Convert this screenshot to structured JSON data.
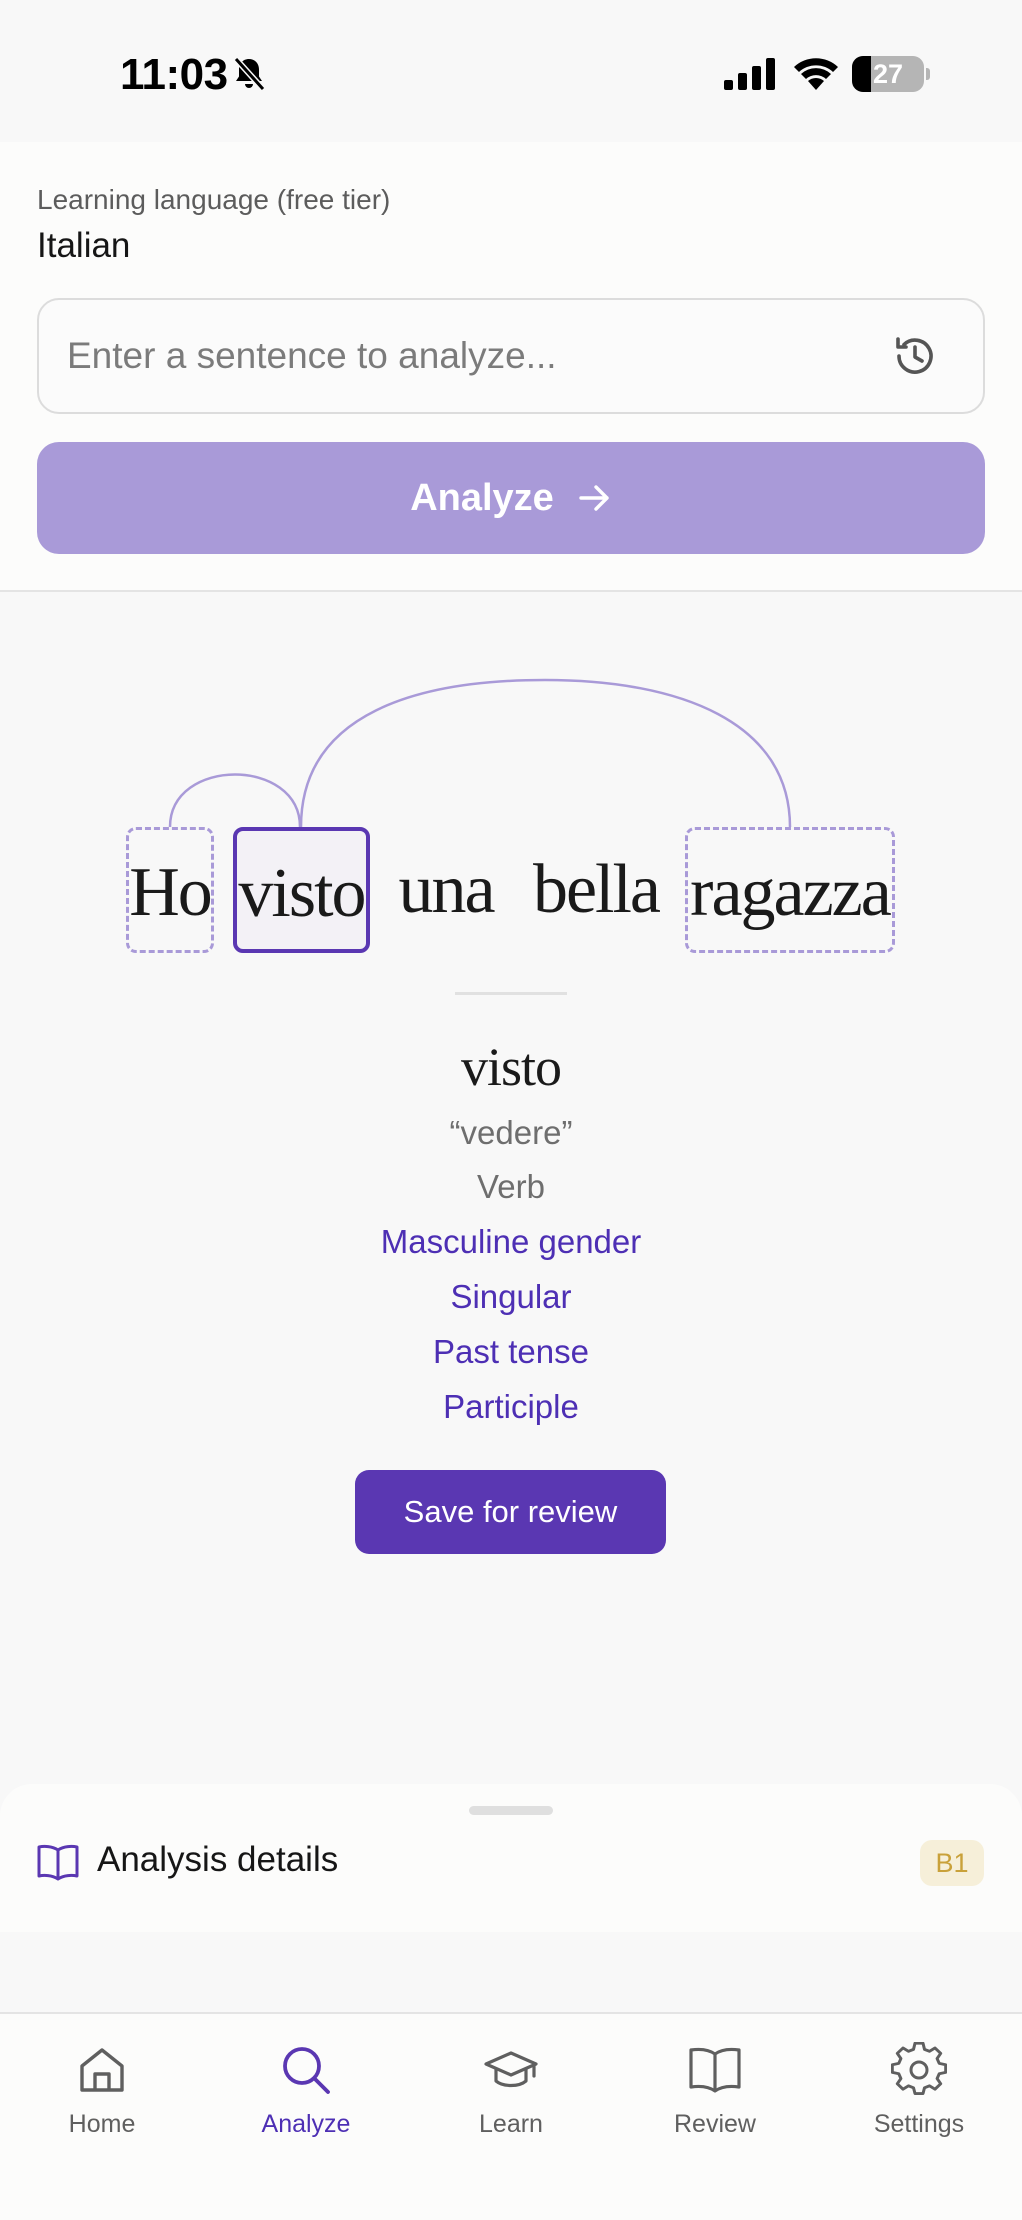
{
  "status_bar": {
    "time": "11:03",
    "battery_level": "27",
    "battery_fraction": 0.27
  },
  "top": {
    "language_label": "Learning language (free tier)",
    "language_value": "Italian",
    "sentence_placeholder": "Enter a sentence to analyze...",
    "sentence_value": "",
    "analyze_label": "Analyze"
  },
  "sentence": {
    "tokens": [
      "Ho",
      "visto",
      "una",
      "bella",
      "ragazza"
    ],
    "selected_token": "visto"
  },
  "detail": {
    "word": "visto",
    "lemma": "“vedere”",
    "pos": "Verb",
    "features": [
      "Masculine gender",
      "Singular",
      "Past tense",
      "Participle"
    ],
    "save_label": "Save for review"
  },
  "sheet": {
    "title": "Analysis details",
    "level_badge": "B1"
  },
  "tabs": [
    {
      "label": "Home",
      "icon": "home-icon"
    },
    {
      "label": "Analyze",
      "icon": "search-icon"
    },
    {
      "label": "Learn",
      "icon": "graduation-cap-icon"
    },
    {
      "label": "Review",
      "icon": "book-open-icon"
    },
    {
      "label": "Settings",
      "icon": "gear-icon"
    }
  ],
  "active_tab": "Analyze",
  "colors": {
    "accent": "#5a37b2",
    "accent_light": "#a99ad8",
    "feature_text": "#4d2fb4",
    "badge_bg": "#f6efd9",
    "badge_text": "#c9a13a"
  }
}
